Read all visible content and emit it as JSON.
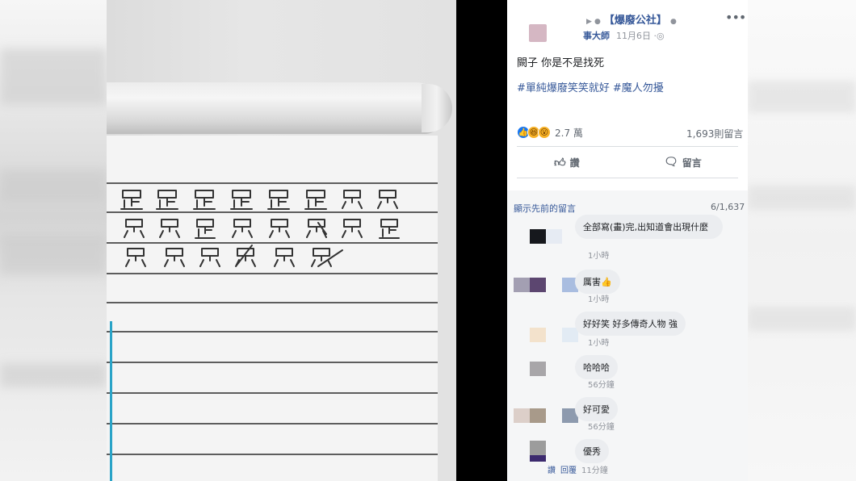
{
  "post": {
    "page_name": "【爆廢公社】",
    "author_fragment": "事大師",
    "date": "11月6日",
    "globe_icon": "public-globe-icon",
    "text": "闕子 你是不是找死",
    "hashtags": [
      "#單純爆廢笑笑就好",
      "#魔人勿擾"
    ],
    "reaction_count": "2.7 萬",
    "comment_count": "1,693則留言",
    "like_label": "讚",
    "comment_label": "留言"
  },
  "comments_section": {
    "prev_comments_label": "顯示先前的留言",
    "count": "6/1,637",
    "items": [
      {
        "text": "全部寫(畫)完,出知道會出現什麼",
        "time": "1小時",
        "avatar_colors": [
          "#16181d",
          "#e6ebf3"
        ]
      },
      {
        "text": "厲害👍",
        "time": "1小時",
        "avatar_colors": [
          "#a39fb2",
          "#5c4670",
          "#a9bde0"
        ]
      },
      {
        "text": "好好笑 好多傳奇人物 強",
        "time": "1小時",
        "avatar_colors": [
          "#f3e2cc",
          "#e2ebf4"
        ]
      },
      {
        "text": "哈哈哈",
        "time": "56分鐘",
        "avatar_colors": [
          "#a8a6a9"
        ]
      },
      {
        "text": "好可愛",
        "time": "56分鐘",
        "avatar_colors": [
          "#dccfc9",
          "#a89a8a",
          "#8d9aae"
        ]
      },
      {
        "text": "優秀",
        "time": "11分鐘",
        "actions": [
          "讚",
          "回覆"
        ],
        "avatar_colors": [
          "#9c9c9c",
          "#3c2a6e"
        ]
      }
    ]
  }
}
